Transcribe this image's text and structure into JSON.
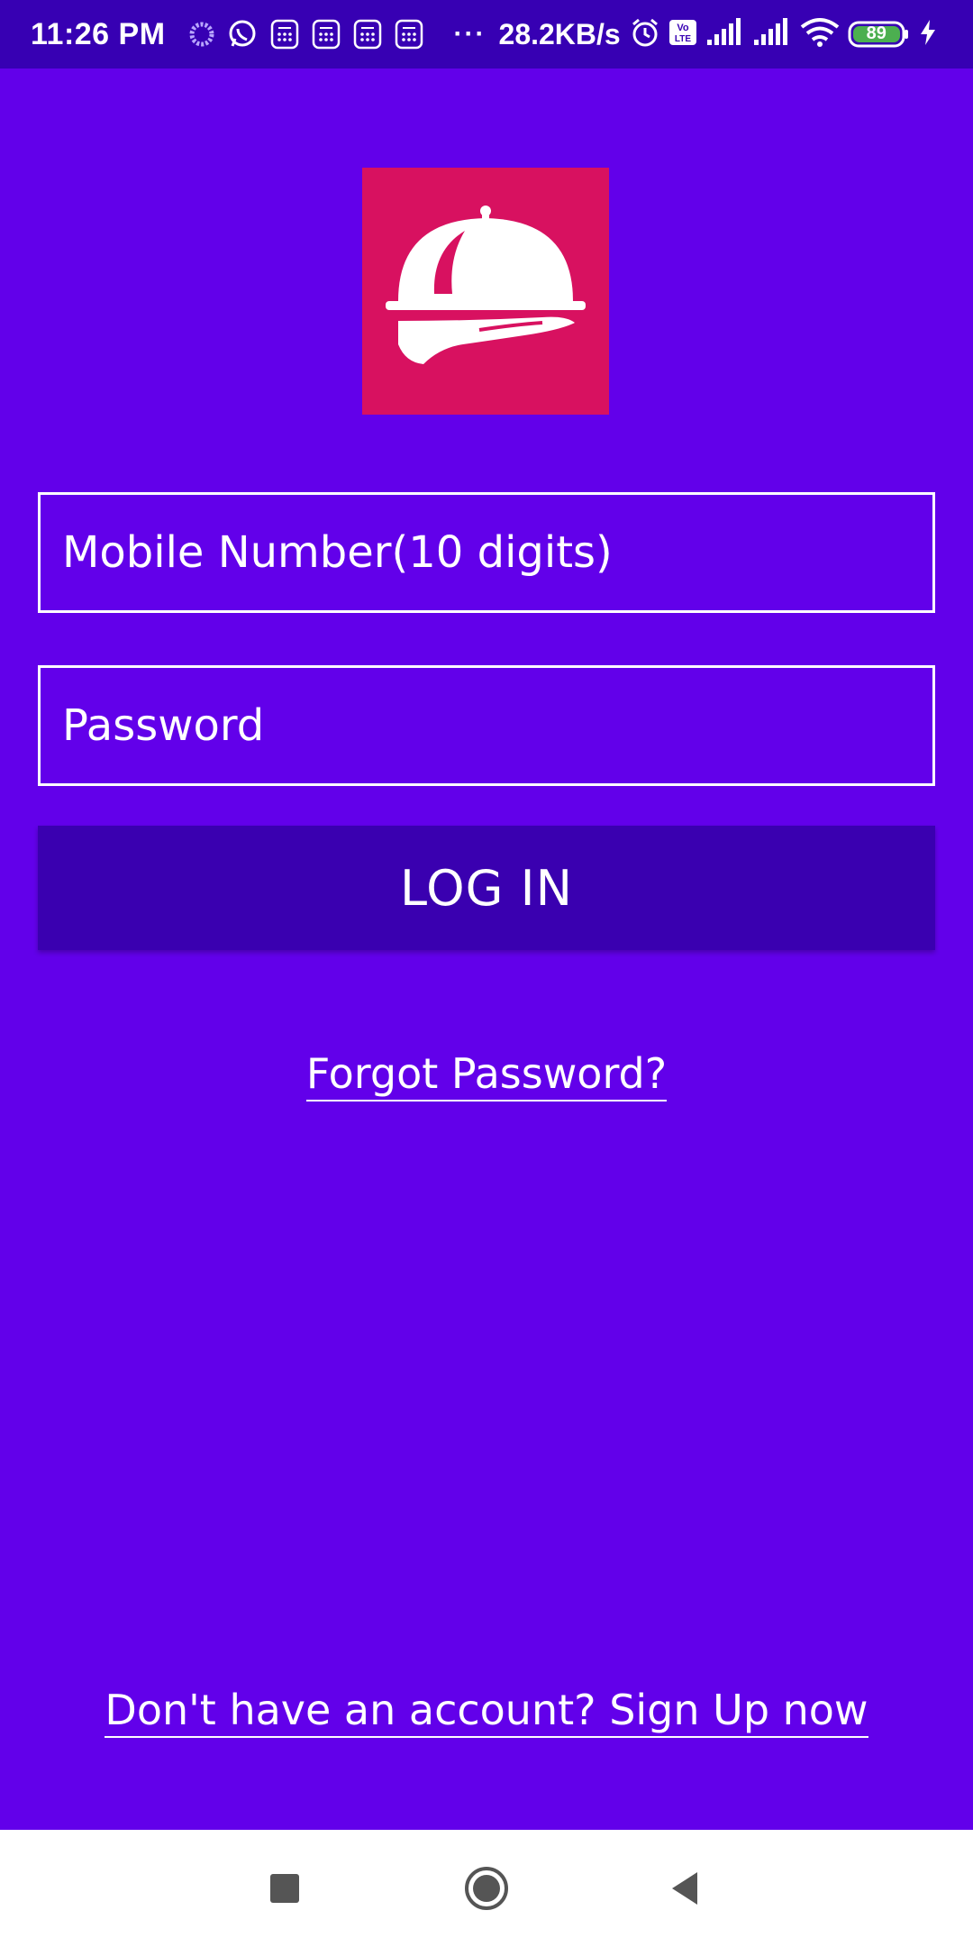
{
  "status_bar": {
    "time": "11:26 PM",
    "dots": "···",
    "speed": "28.2KB/s",
    "battery": "89",
    "icons": [
      "loading-icon",
      "whatsapp-icon",
      "calculator-icon",
      "calculator-icon",
      "calculator-icon",
      "calculator-icon",
      "alarm-icon",
      "volte-icon",
      "signal-icon",
      "signal-icon",
      "wifi-icon",
      "battery-icon",
      "charging-icon"
    ]
  },
  "logo": {
    "icon": "food-cloche-hand-icon",
    "background_color": "#d81160"
  },
  "form": {
    "mobile_placeholder": "Mobile Number(10 digits)",
    "mobile_value": "",
    "password_placeholder": "Password",
    "password_value": "",
    "login_label": "LOG IN"
  },
  "links": {
    "forgot_password": "Forgot Password?",
    "signup": "Don't have an account? Sign Up now"
  },
  "nav_bar": {
    "recent_icon": "square-icon",
    "home_icon": "circle-icon",
    "back_icon": "triangle-back-icon"
  },
  "colors": {
    "background": "#6200ea",
    "status_bar": "#3700b3",
    "button": "#3a00b0",
    "logo": "#d81160"
  }
}
